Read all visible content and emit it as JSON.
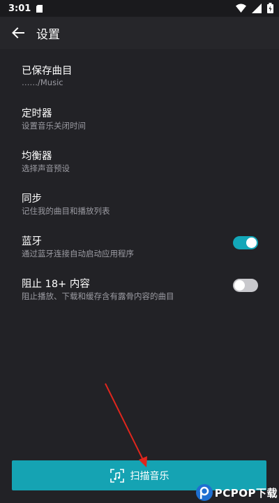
{
  "status_bar": {
    "time": "3:01"
  },
  "app_bar": {
    "title": "设置"
  },
  "settings": [
    {
      "title": "已保存曲目",
      "subtitle": "……/Music"
    },
    {
      "title": "定时器",
      "subtitle": "设置音乐关闭时间"
    },
    {
      "title": "均衡器",
      "subtitle": "选择声音预设"
    },
    {
      "title": "同步",
      "subtitle": "记住我的曲目和播放列表"
    },
    {
      "title": "蓝牙",
      "subtitle": "通过蓝牙连接自动启动应用程序",
      "toggle": "on"
    },
    {
      "title": "阻止 18+ 内容",
      "subtitle": "阻止播放、下载和缓存含有露骨内容的曲目",
      "toggle": "off"
    }
  ],
  "scan_button": {
    "label": "扫描音乐"
  },
  "watermark": {
    "text": "PCPOP下载"
  },
  "colors": {
    "accent": "#15a3b3",
    "background": "#222226",
    "arrow": "#e0261d"
  }
}
